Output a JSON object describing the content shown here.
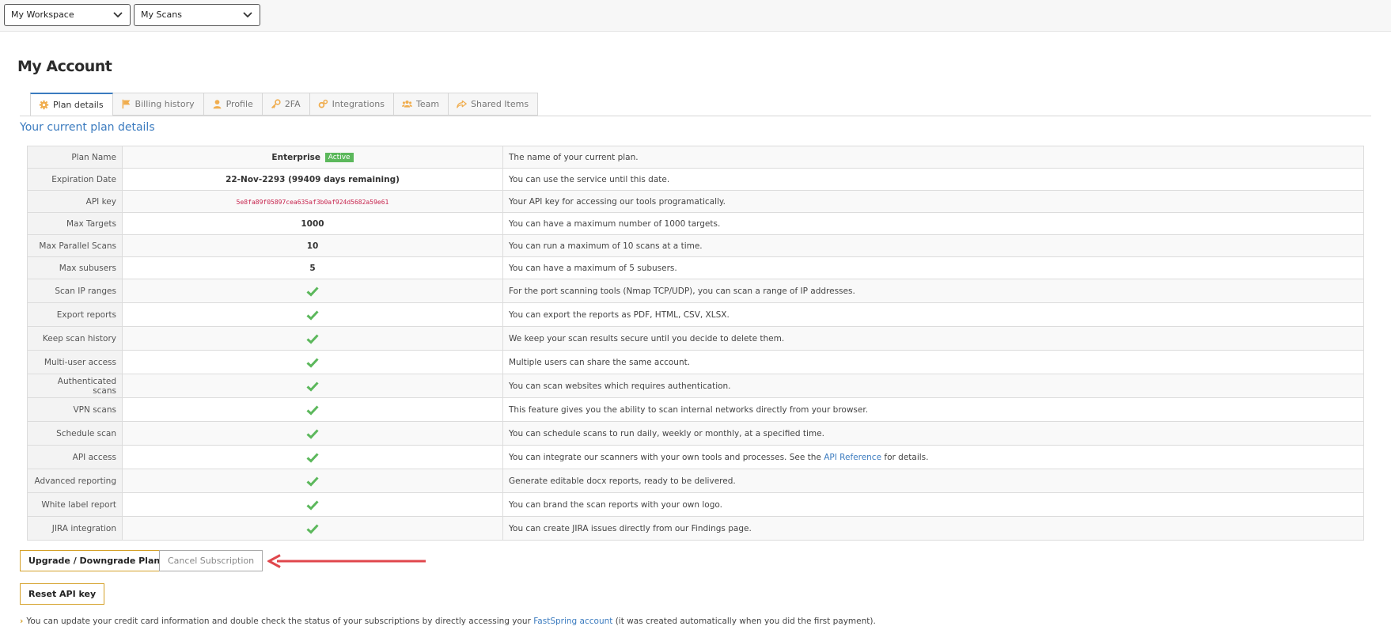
{
  "topbar": {
    "workspace_select": "My Workspace",
    "scans_select": "My Scans"
  },
  "page": {
    "title": "My Account",
    "section_title": "Your current plan details"
  },
  "tabs": [
    {
      "label": "Plan details",
      "icon": "gear-icon",
      "active": true
    },
    {
      "label": "Billing history",
      "icon": "flag-icon"
    },
    {
      "label": "Profile",
      "icon": "user-icon"
    },
    {
      "label": "2FA",
      "icon": "key-icon"
    },
    {
      "label": "Integrations",
      "icon": "gears-icon"
    },
    {
      "label": "Team",
      "icon": "users-icon"
    },
    {
      "label": "Shared Items",
      "icon": "share-icon"
    }
  ],
  "plan": {
    "plan_name": {
      "label": "Plan Name",
      "value": "Enterprise",
      "badge": "Active",
      "desc": "The name of your current plan."
    },
    "expiration": {
      "label": "Expiration Date",
      "value": "22-Nov-2293 (99409 days remaining)",
      "desc": "You can use the service until this date."
    },
    "api_key": {
      "label": "API key",
      "value": "5e8fa89f05897cea635af3b0af924d5682a59e61",
      "desc": "Your API key for accessing our tools programatically."
    },
    "max_targets": {
      "label": "Max Targets",
      "value": "1000",
      "desc": "You can have a maximum number of 1000 targets."
    },
    "max_parallel": {
      "label": "Max Parallel Scans",
      "value": "10",
      "desc": "You can run a maximum of 10 scans at a time."
    },
    "max_subusers": {
      "label": "Max subusers",
      "value": "5",
      "desc": "You can have a maximum of 5 subusers."
    },
    "features": [
      {
        "label": "Scan IP ranges",
        "desc": "For the port scanning tools (Nmap TCP/UDP), you can scan a range of IP addresses."
      },
      {
        "label": "Export reports",
        "desc": "You can export the reports as PDF, HTML, CSV, XLSX."
      },
      {
        "label": "Keep scan history",
        "desc": "We keep your scan results secure until you decide to delete them."
      },
      {
        "label": "Multi-user access",
        "desc": "Multiple users can share the same account."
      },
      {
        "label": "Authenticated scans",
        "desc": "You can scan websites which requires authentication."
      },
      {
        "label": "VPN scans",
        "desc": "This feature gives you the ability to scan internal networks directly from your browser."
      },
      {
        "label": "Schedule scan",
        "desc": "You can schedule scans to run daily, weekly or monthly, at a specified time."
      },
      {
        "label": "API access",
        "desc_before": "You can integrate our scanners with your own tools and processes. See the ",
        "desc_link": "API Reference",
        "desc_after": " for details."
      },
      {
        "label": "Advanced reporting",
        "desc": "Generate editable docx reports, ready to be delivered."
      },
      {
        "label": "White label report",
        "desc": "You can brand the scan reports with your own logo."
      },
      {
        "label": "JIRA integration",
        "desc": "You can create JIRA issues directly from our Findings page."
      }
    ]
  },
  "buttons": {
    "upgrade": "Upgrade / Downgrade Plan",
    "cancel": "Cancel Subscription",
    "reset_api": "Reset API key"
  },
  "footnote": {
    "before": "You can update your credit card information and double check the status of your subscriptions by directly accessing your ",
    "link": "FastSpring account",
    "after": " (it was created automatically when you did the first payment)."
  },
  "colors": {
    "accent_blue": "#3b7bbf",
    "check_green": "#5cb85c",
    "button_border": "#d4a028",
    "arrow_red": "#e0474c",
    "tab_icon_orange": "#f0ad4e"
  }
}
